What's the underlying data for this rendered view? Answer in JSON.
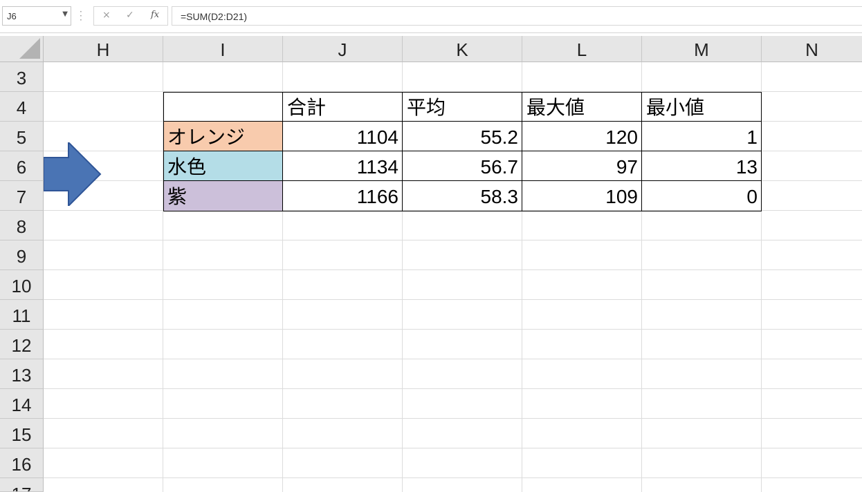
{
  "formula_bar": {
    "name_box": "J6",
    "cancel_icon": "×",
    "enter_icon": "✓",
    "fx_label": "fx",
    "formula": "=SUM(D2:D21)"
  },
  "columns": [
    "H",
    "I",
    "J",
    "K",
    "L",
    "M",
    "N"
  ],
  "rows": [
    "3",
    "4",
    "5",
    "6",
    "7",
    "8",
    "9",
    "10",
    "11",
    "12",
    "13",
    "14",
    "15",
    "16",
    "17"
  ],
  "table": {
    "headers": [
      "",
      "合計",
      "平均",
      "最大値",
      "最小値"
    ],
    "rows": [
      {
        "label": "オレンジ",
        "color": "#f8cbad",
        "values": [
          "1104",
          "55.2",
          "120",
          "1"
        ]
      },
      {
        "label": "水色",
        "color": "#b4dde7",
        "values": [
          "1134",
          "56.7",
          "97",
          "13"
        ]
      },
      {
        "label": "紫",
        "color": "#ccc0da",
        "values": [
          "1166",
          "58.3",
          "109",
          "0"
        ]
      }
    ]
  },
  "arrow": {
    "icon": "right-arrow-shape",
    "color": "#4a74b4"
  }
}
